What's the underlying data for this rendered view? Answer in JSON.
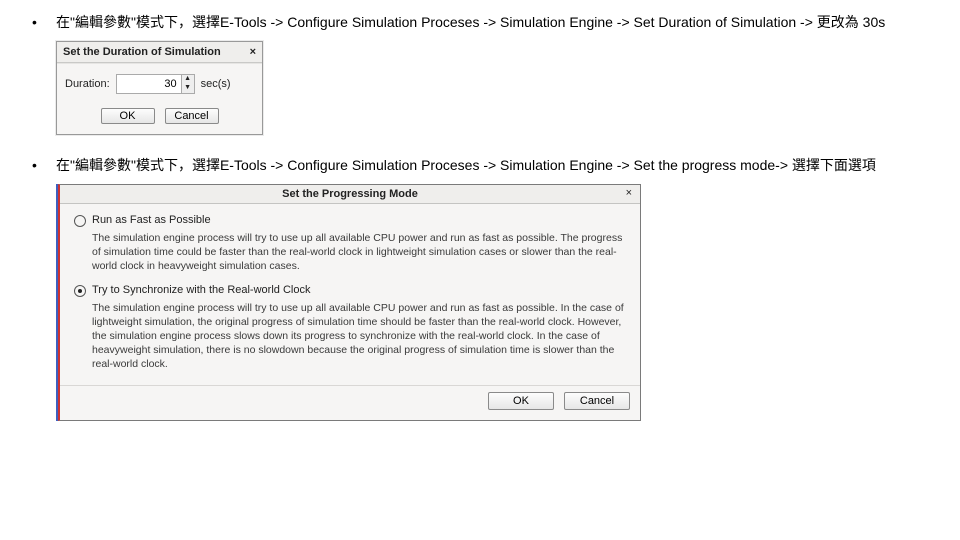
{
  "bullets": {
    "item1": "在\"編輯參數\"模式下，選擇E-Tools -> Configure Simulation Proceses -> Simulation Engine -> Set Duration of Simulation -> 更改為 30s",
    "item2": "在\"編輯參數\"模式下，選擇E-Tools -> Configure Simulation Proceses -> Simulation Engine -> Set the progress mode-> 選擇下面選項"
  },
  "dlg1": {
    "title": "Set the Duration of Simulation",
    "close": "×",
    "duration_label": "Duration:",
    "duration_value": "30",
    "unit": "sec(s)",
    "ok": "OK",
    "cancel": "Cancel"
  },
  "dlg2": {
    "title": "Set the Progressing Mode",
    "close": "×",
    "opt1": {
      "label": "Run as Fast as Possible",
      "desc": "The simulation engine process will try to use up all available CPU power and run as fast as possible. The progress of simulation time could be faster than the real-world clock in lightweight simulation cases or slower than the real-world clock in heavyweight simulation cases."
    },
    "opt2": {
      "label": "Try to Synchronize with the Real-world Clock",
      "desc": "The simulation engine process will try to use up all available CPU power and run as fast as possible. In the case of lightweight simulation, the original progress of simulation time should be faster than the real-world clock. However, the simulation engine process slows down its progress to synchronize with the real-world clock. In the case of heavyweight simulation, there is no slowdown because the original progress of simulation time is slower than the real-world clock."
    },
    "ok": "OK",
    "cancel": "Cancel"
  }
}
